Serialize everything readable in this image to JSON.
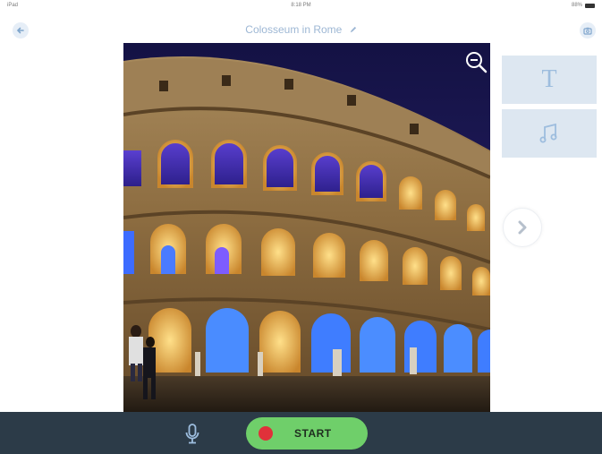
{
  "status_bar": {
    "carrier": "iPad",
    "time": "8:18 PM",
    "battery": "88%"
  },
  "nav": {
    "title": "Colosseum in Rome",
    "back_icon": "back-arrow-icon",
    "camera_icon": "camera-icon",
    "edit_icon": "pencil-icon"
  },
  "photo": {
    "zoom_icon": "zoom-out-icon"
  },
  "side_tools": {
    "text_tool_glyph": "T",
    "music_icon": "music-note-icon",
    "next_icon": "chevron-right-icon"
  },
  "bottom_bar": {
    "mic_icon": "microphone-icon",
    "start_label": "START"
  },
  "colors": {
    "accent_blue": "#9db7d4",
    "tool_card_bg": "#dde7f1",
    "bottom_bar_bg": "#2c3b48",
    "start_green": "#6fcf6a",
    "record_red": "#e0313a"
  }
}
